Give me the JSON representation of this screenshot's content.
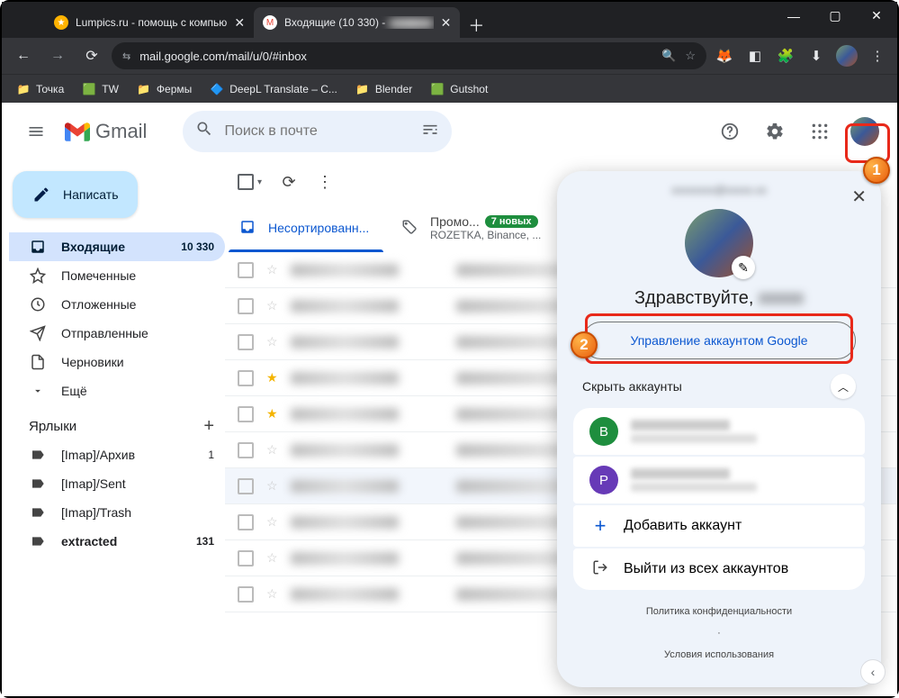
{
  "window": {
    "min": "—",
    "max": "▢",
    "close": "✕"
  },
  "tabs": [
    {
      "favColor": "#ffb300",
      "favGlyph": "★",
      "title": "Lumpics.ru - помощь с компью"
    },
    {
      "favColor": "#ea4335",
      "favGlyph": "M",
      "title": "Входящие (10 330) -"
    }
  ],
  "url": "mail.google.com/mail/u/0/#inbox",
  "bookmarks": [
    {
      "icon": "📁",
      "label": "Точка"
    },
    {
      "icon": "🟩",
      "label": "TW"
    },
    {
      "icon": "📁",
      "label": "Фермы"
    },
    {
      "icon": "🔷",
      "label": "DeepL Translate – С..."
    },
    {
      "icon": "📁",
      "label": "Blender"
    },
    {
      "icon": "🟩",
      "label": "Gutshot"
    }
  ],
  "gmail": {
    "brand": "Gmail",
    "search_placeholder": "Поиск в почте",
    "compose": "Написать",
    "nav": [
      {
        "icon": "inbox",
        "label": "Входящие",
        "count": "10 330",
        "active": true
      },
      {
        "icon": "star",
        "label": "Помеченные"
      },
      {
        "icon": "clock",
        "label": "Отложенные"
      },
      {
        "icon": "send",
        "label": "Отправленные"
      },
      {
        "icon": "draft",
        "label": "Черновики"
      },
      {
        "icon": "more",
        "label": "Ещё"
      }
    ],
    "labels_header": "Ярлыки",
    "labels": [
      {
        "label": "[Imap]/Архив",
        "count": "1"
      },
      {
        "label": "[Imap]/Sent"
      },
      {
        "label": "[Imap]/Trash"
      },
      {
        "label": "extracted",
        "count": "131",
        "bold": true
      }
    ],
    "tabs": [
      {
        "label": "Несортированн...",
        "active": true
      },
      {
        "label": "Промо...",
        "pill": "7 новых",
        "sub": "ROZETKA, Binance, ..."
      }
    ],
    "rows": 10
  },
  "acct": {
    "greeting_prefix": "Здравствуйте, ",
    "manage": "Управление аккаунтом Google",
    "hide": "Скрыть аккаунты",
    "others": [
      {
        "letter": "В",
        "bg": "#1e8e3e"
      },
      {
        "letter": "P",
        "bg": "#673ab7"
      }
    ],
    "add": "Добавить аккаунт",
    "signout": "Выйти из всех аккаунтов",
    "privacy": "Политика конфиденциальности",
    "tos": "Условия использования"
  }
}
